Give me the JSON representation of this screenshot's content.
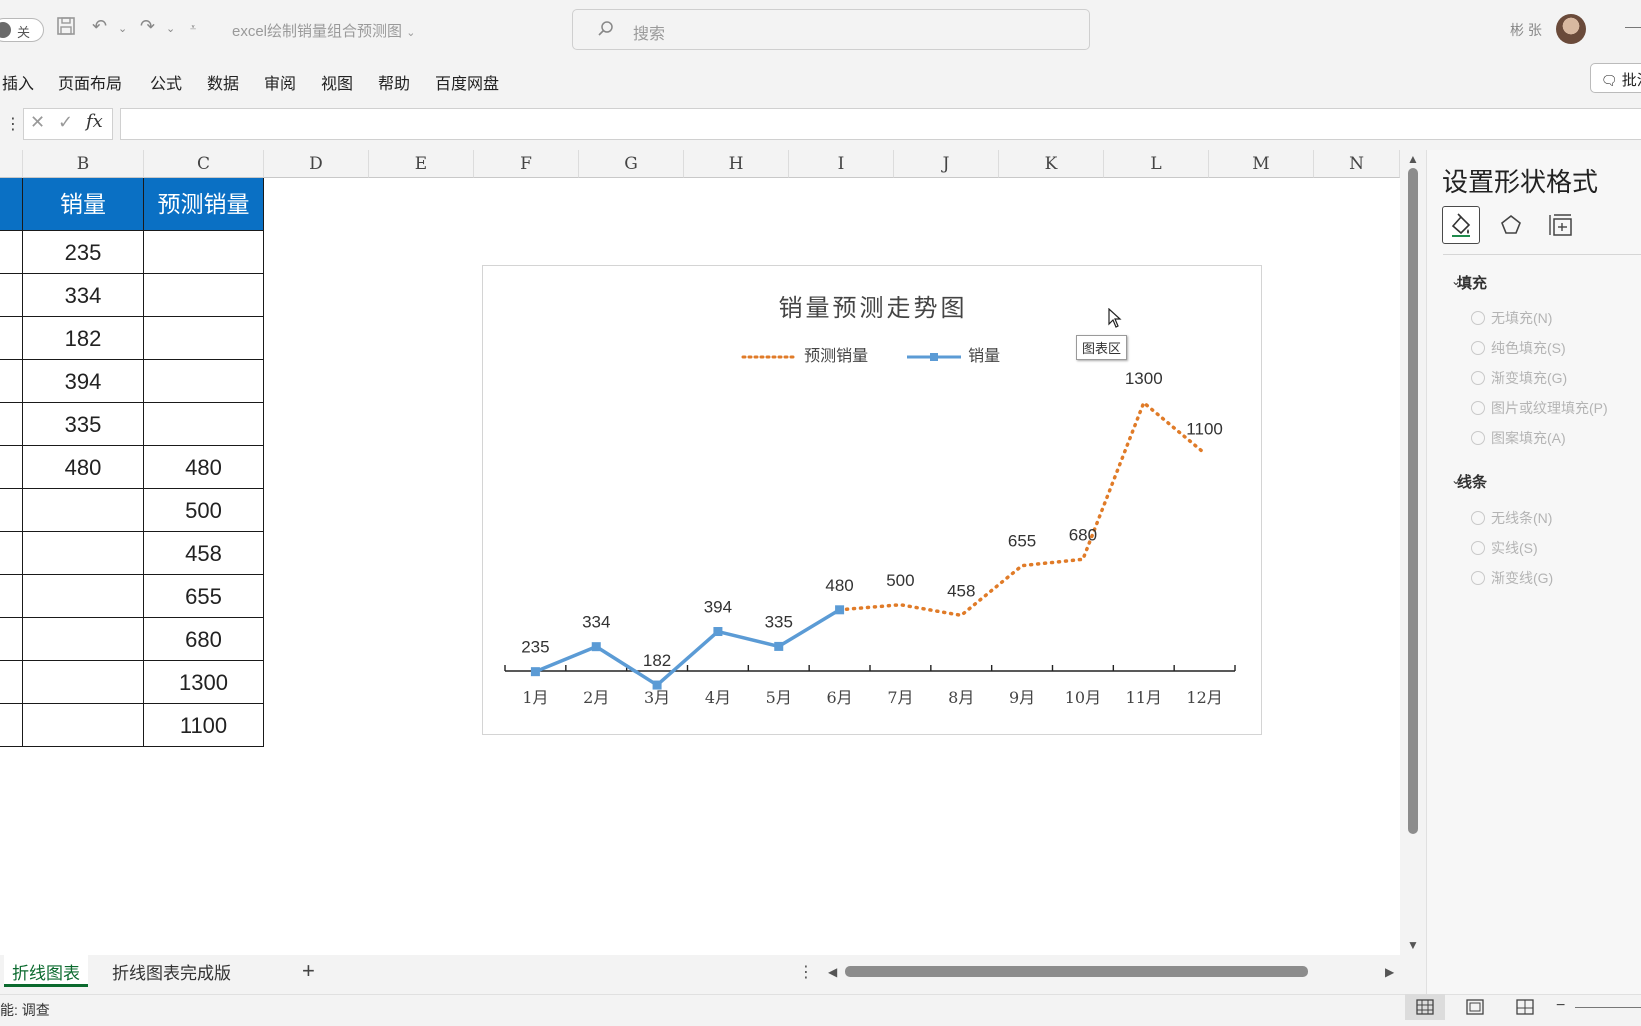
{
  "titlebar": {
    "autosave_label": "关",
    "doc_title": "excel绘制销量组合预测图",
    "search_placeholder": "搜索",
    "user_name": "彬 张"
  },
  "menu": {
    "items": [
      "插入",
      "页面布局",
      "公式",
      "数据",
      "审阅",
      "视图",
      "帮助",
      "百度网盘"
    ],
    "comment_label": "批注"
  },
  "formula_bar": {
    "fx_label": "fx",
    "value": ""
  },
  "columns": [
    "B",
    "C",
    "D",
    "E",
    "F",
    "G",
    "H",
    "I",
    "J",
    "K",
    "L",
    "M",
    "N"
  ],
  "table": {
    "headers": [
      "销量",
      "预测销量"
    ],
    "rows": [
      [
        "235",
        ""
      ],
      [
        "334",
        ""
      ],
      [
        "182",
        ""
      ],
      [
        "394",
        ""
      ],
      [
        "335",
        ""
      ],
      [
        "480",
        "480"
      ],
      [
        "",
        "500"
      ],
      [
        "",
        "458"
      ],
      [
        "",
        "655"
      ],
      [
        "",
        "680"
      ],
      [
        "",
        "1300"
      ],
      [
        "",
        "1100"
      ]
    ]
  },
  "chart_tooltip": "图表区",
  "chart_data": {
    "type": "line",
    "title": "销量预测走势图",
    "categories": [
      "1月",
      "2月",
      "3月",
      "4月",
      "5月",
      "6月",
      "7月",
      "8月",
      "9月",
      "10月",
      "11月",
      "12月"
    ],
    "series": [
      {
        "name": "预测销量",
        "values": [
          null,
          null,
          null,
          null,
          null,
          480,
          500,
          458,
          655,
          680,
          1300,
          1100
        ],
        "color": "#e07b28",
        "style": "dotted"
      },
      {
        "name": "销量",
        "values": [
          235,
          334,
          182,
          394,
          335,
          480,
          null,
          null,
          null,
          null,
          null,
          null
        ],
        "color": "#5b9bd5",
        "style": "solid-square-markers"
      }
    ],
    "data_labels": [
      "235",
      "334",
      "182",
      "394",
      "335",
      "480",
      "500",
      "458",
      "655",
      "680",
      "1300",
      "1100"
    ],
    "legend": "top-center",
    "grid": false
  },
  "pane": {
    "title": "设置形状格式",
    "tabs": [
      "fill-line-icon",
      "effects-icon",
      "size-properties-icon"
    ],
    "fill_section": "填充",
    "fill_options": [
      "无填充(N)",
      "纯色填充(S)",
      "渐变填充(G)",
      "图片或纹理填充(P)",
      "图案填充(A)"
    ],
    "line_section": "线条",
    "line_options": [
      "无线条(N)",
      "实线(S)",
      "渐变线(G)"
    ]
  },
  "sheets": {
    "tabs": [
      "折线图表",
      "折线图表完成版"
    ],
    "active": "折线图表"
  },
  "status": {
    "text": "能: 调查"
  },
  "colors": {
    "header_blue": "#0a70c4",
    "sheet_green": "#0b6a2e",
    "actual_line": "#5b9bd5",
    "forecast_line": "#e07b28"
  }
}
